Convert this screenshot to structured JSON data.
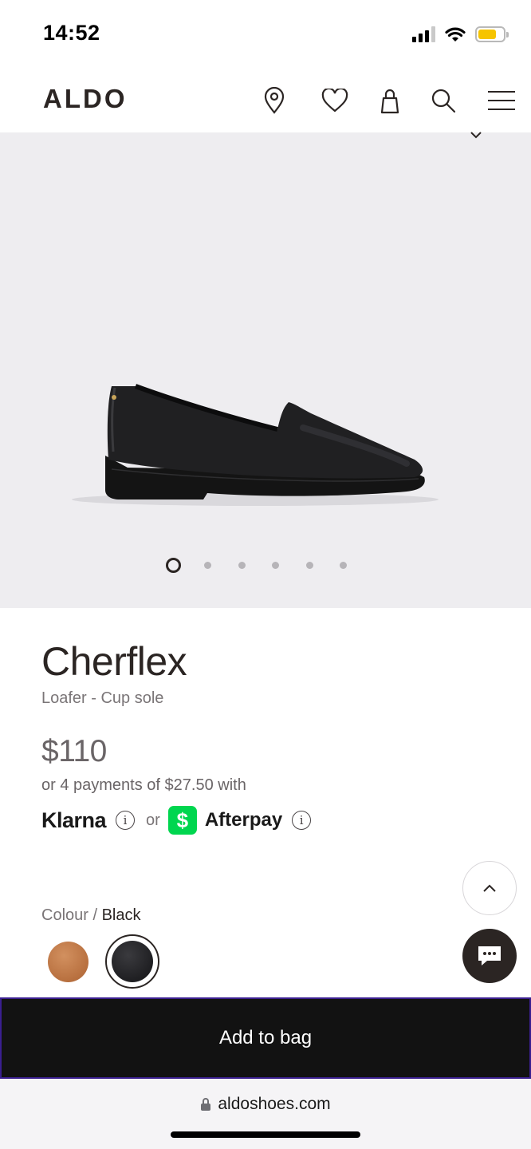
{
  "status": {
    "time": "14:52"
  },
  "header": {
    "logo": "ALDO"
  },
  "gallery": {
    "slide_count": 6,
    "active_slide": 1
  },
  "product": {
    "name": "Cherflex",
    "subtitle": "Loafer - Cup sole",
    "price": "$110",
    "installments": "or 4 payments of $27.50 with",
    "klarna": "Klarna",
    "or": "or",
    "afterpay": "Afterpay",
    "info": "i"
  },
  "colour": {
    "label": "Colour",
    "separator": " / ",
    "selected": "Black",
    "swatches": [
      {
        "name": "tan",
        "color": "#b8703f"
      },
      {
        "name": "black",
        "color": "#1f1f22"
      }
    ]
  },
  "cta": {
    "add_to_bag": "Add to bag"
  },
  "browser": {
    "url": "aldoshoes.com"
  },
  "colors": {
    "primary": "#121212",
    "brand_text": "#2b2523",
    "gallery_bg": "#eeedf0",
    "cashapp_green": "#00d64f",
    "battery": "#f6c400"
  }
}
